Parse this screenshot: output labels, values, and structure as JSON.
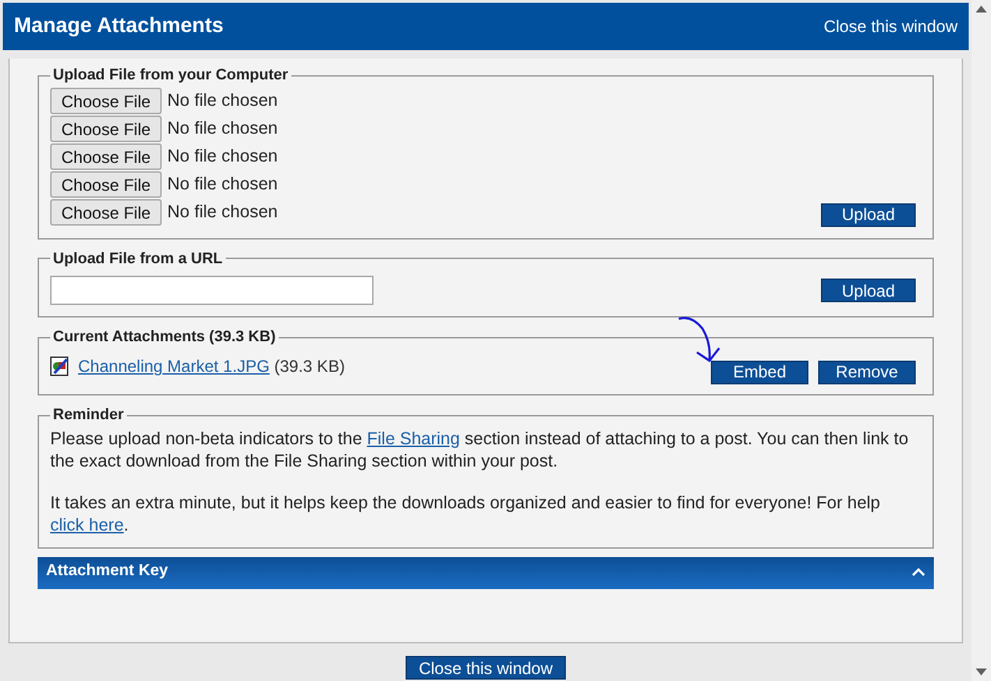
{
  "window": {
    "title": "Manage Attachments",
    "close_link": "Close this window"
  },
  "upload_computer": {
    "legend": "Upload File from your Computer",
    "files": [
      {
        "button": "Choose File",
        "status": "No file chosen"
      },
      {
        "button": "Choose File",
        "status": "No file chosen"
      },
      {
        "button": "Choose File",
        "status": "No file chosen"
      },
      {
        "button": "Choose File",
        "status": "No file chosen"
      },
      {
        "button": "Choose File",
        "status": "No file chosen"
      }
    ],
    "button": "Upload"
  },
  "upload_url": {
    "legend": "Upload File from a URL",
    "button": "Upload"
  },
  "current": {
    "legend": "Current Attachments (39.3 KB)",
    "attachments": [
      {
        "name": "Channeling Market 1.JPG",
        "size": "(39.3 KB)",
        "actions": [
          "Embed",
          "Remove"
        ]
      }
    ]
  },
  "reminder": {
    "legend": "Reminder",
    "paragraphs": [
      [
        {
          "kind": "text",
          "text": "Please upload non-beta indicators to the "
        },
        {
          "kind": "link",
          "text": "File Sharing"
        },
        {
          "kind": "text",
          "text": " section instead of attaching to a post. You can then link to the exact download from the File Sharing section within your post."
        }
      ],
      [
        {
          "kind": "text",
          "text": "It takes an extra minute, but it helps keep the downloads organized and easier to find for everyone! For help "
        },
        {
          "kind": "link",
          "text": "click here"
        },
        {
          "kind": "text",
          "text": "."
        }
      ]
    ]
  },
  "attachment_key": {
    "title": "Attachment Key",
    "expanded": true
  },
  "footer": {
    "button": "Close this window"
  }
}
